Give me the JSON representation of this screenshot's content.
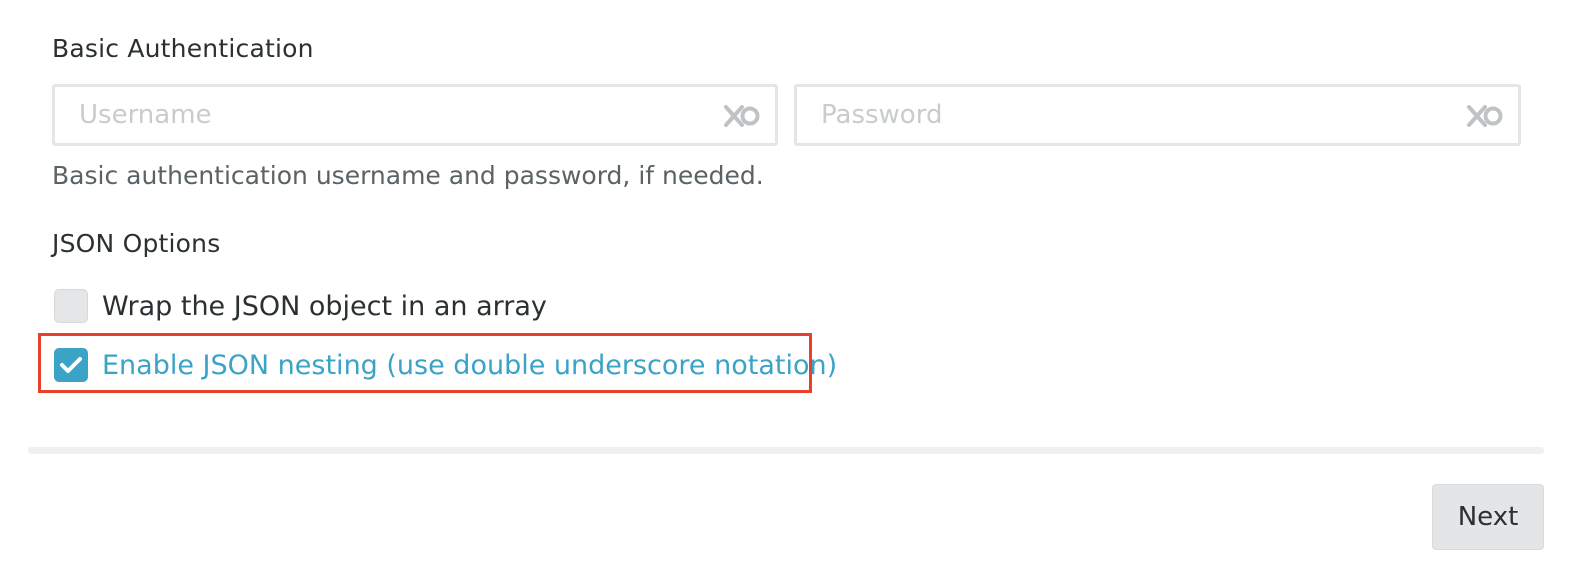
{
  "basic_auth": {
    "title": "Basic Authentication",
    "username": {
      "placeholder": "Username",
      "value": "",
      "clear_icon": "clear-input-icon"
    },
    "password": {
      "placeholder": "Password",
      "value": "",
      "clear_icon": "clear-input-icon"
    },
    "help_text": "Basic authentication username and password, if needed."
  },
  "json_options": {
    "title": "JSON Options",
    "wrap_array": {
      "label": "Wrap the JSON object in an array",
      "checked": false
    },
    "nesting": {
      "label": "Enable JSON nesting (use double underscore notation)",
      "checked": true
    }
  },
  "footer": {
    "next_label": "Next"
  },
  "colors": {
    "accent": "#3aa3c6",
    "highlight": "#e8402a",
    "text": "#2b3033",
    "muted": "#5b6266",
    "placeholder": "#c8ccce"
  }
}
